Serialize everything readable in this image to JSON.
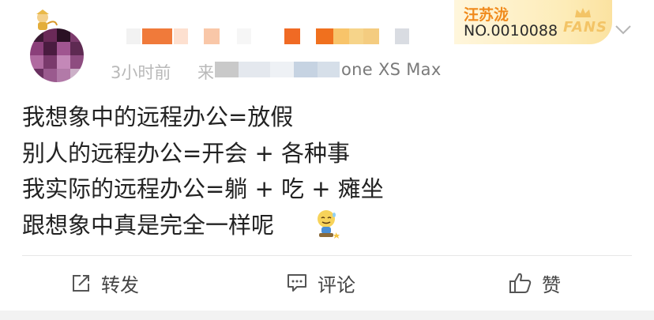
{
  "post": {
    "time_prefix": "3小时前",
    "source_prefix": "来",
    "device": "one XS Max",
    "lines": [
      "我想象中的远程办公=放假",
      "别人的远程办公=开会 + 各种事",
      "我实际的远程办公=躺 + 吃 + 瘫坐",
      "跟想象中真是完全一样呢"
    ]
  },
  "fans_badge": {
    "name": "汪苏泷",
    "number": "NO.0010088",
    "logo": "FANS"
  },
  "actions": {
    "repost": "转发",
    "comment": "评论",
    "like": "赞"
  },
  "colors": {
    "accent_orange": "#f08a1c",
    "badge_gold": "#f3c466",
    "text_main": "#222222",
    "text_meta": "#8a8a8a"
  }
}
